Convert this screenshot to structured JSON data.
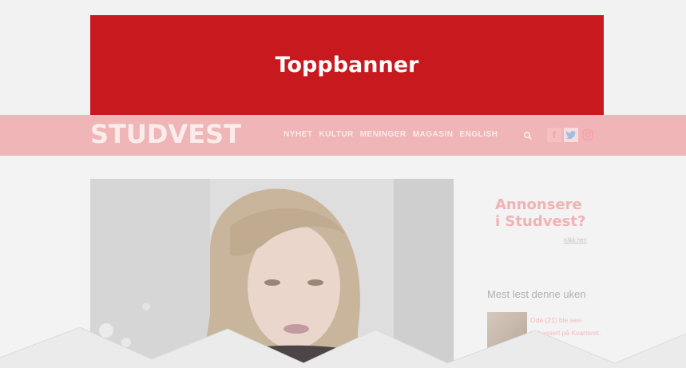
{
  "banner": {
    "label": "Toppbanner"
  },
  "header": {
    "logo": "STUDVEST",
    "nav": [
      "NYHET",
      "KULTUR",
      "MENINGER",
      "MAGASIN",
      "ENGLISH"
    ],
    "social": {
      "facebook": "f",
      "twitter": "t",
      "instagram": "ig"
    }
  },
  "sidebar": {
    "ad": {
      "line1": "Annonsere",
      "line2": "i Studvest?",
      "link": "Klikk her!"
    },
    "most_read": {
      "heading": "Mest lest denne uken",
      "items": [
        {
          "title": "Oda (21) ble sex-trakassert på Kvarteret."
        }
      ]
    }
  },
  "colors": {
    "accent": "#c8191e",
    "header_bg": "#efb5b7"
  }
}
